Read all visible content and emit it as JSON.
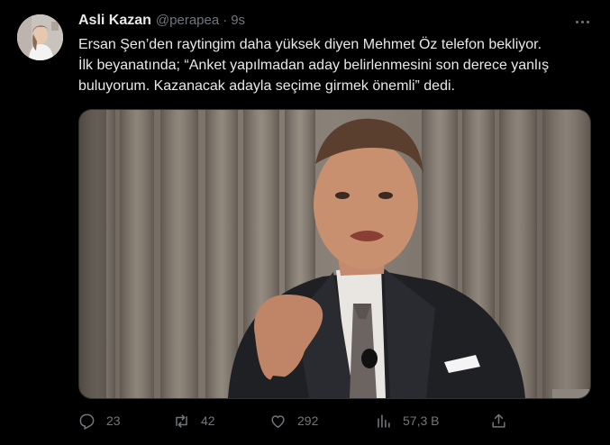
{
  "tweet": {
    "author_name": "Asli Kazan",
    "handle": "@perapea",
    "separator": "·",
    "time": "9s",
    "text_lines": [
      "Ersan Şen’den raytingim daha yüksek diyen Mehmet Öz telefon bekliyor.",
      "İlk beyanatında; “Anket yapılmadan aday belirlenmesini son derece yanlış",
      "buluyorum. Kazanacak adayla seçime girmek önemli” dedi."
    ],
    "actions": {
      "replies": "23",
      "reposts": "42",
      "likes": "292",
      "views": "57,3 B"
    }
  },
  "colors": {
    "background": "#000000",
    "primary_text": "#e7e9ea",
    "secondary_text": "#71767b"
  },
  "icons": {
    "more": "more-dots-icon",
    "reply": "reply-icon",
    "repost": "repost-icon",
    "like": "like-icon",
    "views": "views-icon",
    "share": "share-icon"
  }
}
